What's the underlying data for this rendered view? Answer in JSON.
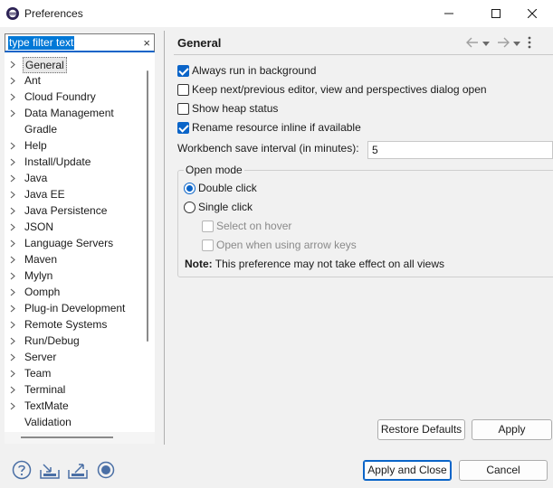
{
  "window": {
    "title": "Preferences",
    "controls": {
      "minimize": "minimize-icon",
      "maximize": "maximize-icon",
      "close": "close-icon"
    }
  },
  "filter": {
    "value": "type filter text",
    "clear_icon": "clear-icon",
    "clear_glyph": "×"
  },
  "tree": {
    "items": [
      {
        "label": "General",
        "expandable": true,
        "selected": true
      },
      {
        "label": "Ant",
        "expandable": true
      },
      {
        "label": "Cloud Foundry",
        "expandable": true
      },
      {
        "label": "Data Management",
        "expandable": true
      },
      {
        "label": "Gradle",
        "expandable": false
      },
      {
        "label": "Help",
        "expandable": true
      },
      {
        "label": "Install/Update",
        "expandable": true
      },
      {
        "label": "Java",
        "expandable": true
      },
      {
        "label": "Java EE",
        "expandable": true
      },
      {
        "label": "Java Persistence",
        "expandable": true
      },
      {
        "label": "JSON",
        "expandable": true
      },
      {
        "label": "Language Servers",
        "expandable": true
      },
      {
        "label": "Maven",
        "expandable": true
      },
      {
        "label": "Mylyn",
        "expandable": true
      },
      {
        "label": "Oomph",
        "expandable": true
      },
      {
        "label": "Plug-in Development",
        "expandable": true
      },
      {
        "label": "Remote Systems",
        "expandable": true
      },
      {
        "label": "Run/Debug",
        "expandable": true
      },
      {
        "label": "Server",
        "expandable": true
      },
      {
        "label": "Team",
        "expandable": true
      },
      {
        "label": "Terminal",
        "expandable": true
      },
      {
        "label": "TextMate",
        "expandable": true
      },
      {
        "label": "Validation",
        "expandable": false
      }
    ]
  },
  "page": {
    "title": "General",
    "nav": {
      "back_icon": "back-arrow-icon",
      "forward_icon": "forward-arrow-icon",
      "menu_icon": "vertical-dots-icon"
    },
    "checkboxes": [
      {
        "label": "Always run in background",
        "checked": true
      },
      {
        "label": "Keep next/previous editor, view and perspectives dialog open",
        "checked": false
      },
      {
        "label": "Show heap status",
        "checked": false
      },
      {
        "label": "Rename resource inline if available",
        "checked": true
      }
    ],
    "save_interval": {
      "label": "Workbench save interval (in minutes):",
      "value": "5"
    },
    "open_mode": {
      "title": "Open mode",
      "options": [
        {
          "label": "Double click",
          "checked": true
        },
        {
          "label": "Single click",
          "checked": false
        }
      ],
      "sub_options": [
        {
          "label": "Select on hover",
          "checked": false,
          "disabled": true
        },
        {
          "label": "Open when using arrow keys",
          "checked": false,
          "disabled": true
        }
      ]
    },
    "note": {
      "bold": "Note:",
      "text": " This preference may not take effect on all views"
    }
  },
  "buttons": {
    "restore_defaults": "Restore Defaults",
    "apply": "Apply",
    "apply_and_close": "Apply and Close",
    "cancel": "Cancel"
  },
  "bottom_icons": [
    "help-icon",
    "import-icon",
    "export-icon",
    "record-icon"
  ],
  "colors": {
    "accent": "#0a64c8",
    "selection_bg": "#0078d7",
    "panel_bg": "#f1f1f1"
  }
}
